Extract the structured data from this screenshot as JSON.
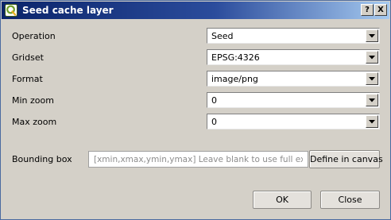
{
  "window": {
    "title": "Seed cache layer",
    "help_button": "?",
    "close_button": "X"
  },
  "form": {
    "rows": [
      {
        "label": "Operation",
        "value": "Seed"
      },
      {
        "label": "Gridset",
        "value": "EPSG:4326"
      },
      {
        "label": "Format",
        "value": "image/png"
      },
      {
        "label": "Min zoom",
        "value": "0"
      },
      {
        "label": "Max zoom",
        "value": "0"
      }
    ],
    "bbox": {
      "label": "Bounding box",
      "placeholder": "[xmin,xmax,ymin,ymax] Leave blank to use full extent",
      "value": "",
      "define_button": "Define in canvas"
    }
  },
  "buttons": {
    "ok": "OK",
    "close": "Close"
  },
  "colors": {
    "title_bar_start": "#0a246a",
    "title_bar_end": "#a6caf0",
    "dialog_background": "#d4d0c8",
    "app_icon": "#6fa02a"
  },
  "icons": {
    "app": "qgis-icon",
    "dropdown": "chevron-down-icon"
  }
}
